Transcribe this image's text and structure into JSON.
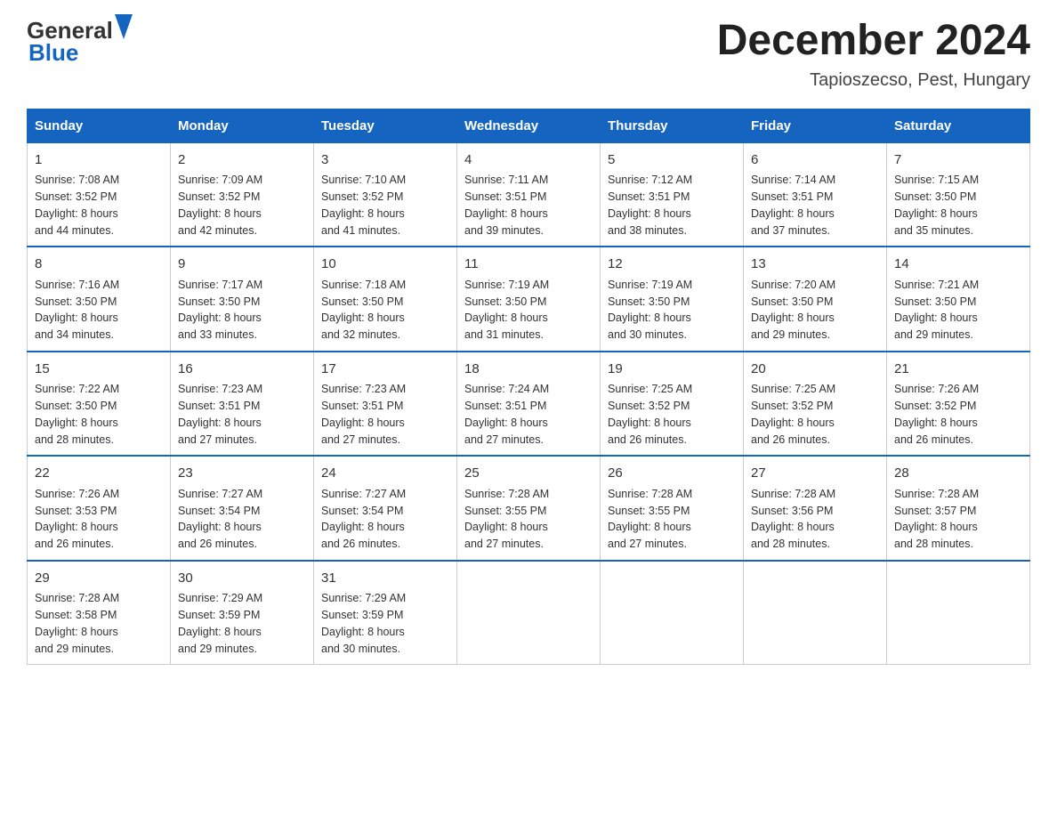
{
  "header": {
    "logo_text_general": "General",
    "logo_text_blue": "Blue",
    "month_title": "December 2024",
    "location": "Tapioszecso, Pest, Hungary"
  },
  "days_of_week": [
    "Sunday",
    "Monday",
    "Tuesday",
    "Wednesday",
    "Thursday",
    "Friday",
    "Saturday"
  ],
  "weeks": [
    [
      {
        "day": "1",
        "sunrise": "7:08 AM",
        "sunset": "3:52 PM",
        "daylight": "8 hours and 44 minutes."
      },
      {
        "day": "2",
        "sunrise": "7:09 AM",
        "sunset": "3:52 PM",
        "daylight": "8 hours and 42 minutes."
      },
      {
        "day": "3",
        "sunrise": "7:10 AM",
        "sunset": "3:52 PM",
        "daylight": "8 hours and 41 minutes."
      },
      {
        "day": "4",
        "sunrise": "7:11 AM",
        "sunset": "3:51 PM",
        "daylight": "8 hours and 39 minutes."
      },
      {
        "day": "5",
        "sunrise": "7:12 AM",
        "sunset": "3:51 PM",
        "daylight": "8 hours and 38 minutes."
      },
      {
        "day": "6",
        "sunrise": "7:14 AM",
        "sunset": "3:51 PM",
        "daylight": "8 hours and 37 minutes."
      },
      {
        "day": "7",
        "sunrise": "7:15 AM",
        "sunset": "3:50 PM",
        "daylight": "8 hours and 35 minutes."
      }
    ],
    [
      {
        "day": "8",
        "sunrise": "7:16 AM",
        "sunset": "3:50 PM",
        "daylight": "8 hours and 34 minutes."
      },
      {
        "day": "9",
        "sunrise": "7:17 AM",
        "sunset": "3:50 PM",
        "daylight": "8 hours and 33 minutes."
      },
      {
        "day": "10",
        "sunrise": "7:18 AM",
        "sunset": "3:50 PM",
        "daylight": "8 hours and 32 minutes."
      },
      {
        "day": "11",
        "sunrise": "7:19 AM",
        "sunset": "3:50 PM",
        "daylight": "8 hours and 31 minutes."
      },
      {
        "day": "12",
        "sunrise": "7:19 AM",
        "sunset": "3:50 PM",
        "daylight": "8 hours and 30 minutes."
      },
      {
        "day": "13",
        "sunrise": "7:20 AM",
        "sunset": "3:50 PM",
        "daylight": "8 hours and 29 minutes."
      },
      {
        "day": "14",
        "sunrise": "7:21 AM",
        "sunset": "3:50 PM",
        "daylight": "8 hours and 29 minutes."
      }
    ],
    [
      {
        "day": "15",
        "sunrise": "7:22 AM",
        "sunset": "3:50 PM",
        "daylight": "8 hours and 28 minutes."
      },
      {
        "day": "16",
        "sunrise": "7:23 AM",
        "sunset": "3:51 PM",
        "daylight": "8 hours and 27 minutes."
      },
      {
        "day": "17",
        "sunrise": "7:23 AM",
        "sunset": "3:51 PM",
        "daylight": "8 hours and 27 minutes."
      },
      {
        "day": "18",
        "sunrise": "7:24 AM",
        "sunset": "3:51 PM",
        "daylight": "8 hours and 27 minutes."
      },
      {
        "day": "19",
        "sunrise": "7:25 AM",
        "sunset": "3:52 PM",
        "daylight": "8 hours and 26 minutes."
      },
      {
        "day": "20",
        "sunrise": "7:25 AM",
        "sunset": "3:52 PM",
        "daylight": "8 hours and 26 minutes."
      },
      {
        "day": "21",
        "sunrise": "7:26 AM",
        "sunset": "3:52 PM",
        "daylight": "8 hours and 26 minutes."
      }
    ],
    [
      {
        "day": "22",
        "sunrise": "7:26 AM",
        "sunset": "3:53 PM",
        "daylight": "8 hours and 26 minutes."
      },
      {
        "day": "23",
        "sunrise": "7:27 AM",
        "sunset": "3:54 PM",
        "daylight": "8 hours and 26 minutes."
      },
      {
        "day": "24",
        "sunrise": "7:27 AM",
        "sunset": "3:54 PM",
        "daylight": "8 hours and 26 minutes."
      },
      {
        "day": "25",
        "sunrise": "7:28 AM",
        "sunset": "3:55 PM",
        "daylight": "8 hours and 27 minutes."
      },
      {
        "day": "26",
        "sunrise": "7:28 AM",
        "sunset": "3:55 PM",
        "daylight": "8 hours and 27 minutes."
      },
      {
        "day": "27",
        "sunrise": "7:28 AM",
        "sunset": "3:56 PM",
        "daylight": "8 hours and 28 minutes."
      },
      {
        "day": "28",
        "sunrise": "7:28 AM",
        "sunset": "3:57 PM",
        "daylight": "8 hours and 28 minutes."
      }
    ],
    [
      {
        "day": "29",
        "sunrise": "7:28 AM",
        "sunset": "3:58 PM",
        "daylight": "8 hours and 29 minutes."
      },
      {
        "day": "30",
        "sunrise": "7:29 AM",
        "sunset": "3:59 PM",
        "daylight": "8 hours and 29 minutes."
      },
      {
        "day": "31",
        "sunrise": "7:29 AM",
        "sunset": "3:59 PM",
        "daylight": "8 hours and 30 minutes."
      },
      null,
      null,
      null,
      null
    ]
  ]
}
